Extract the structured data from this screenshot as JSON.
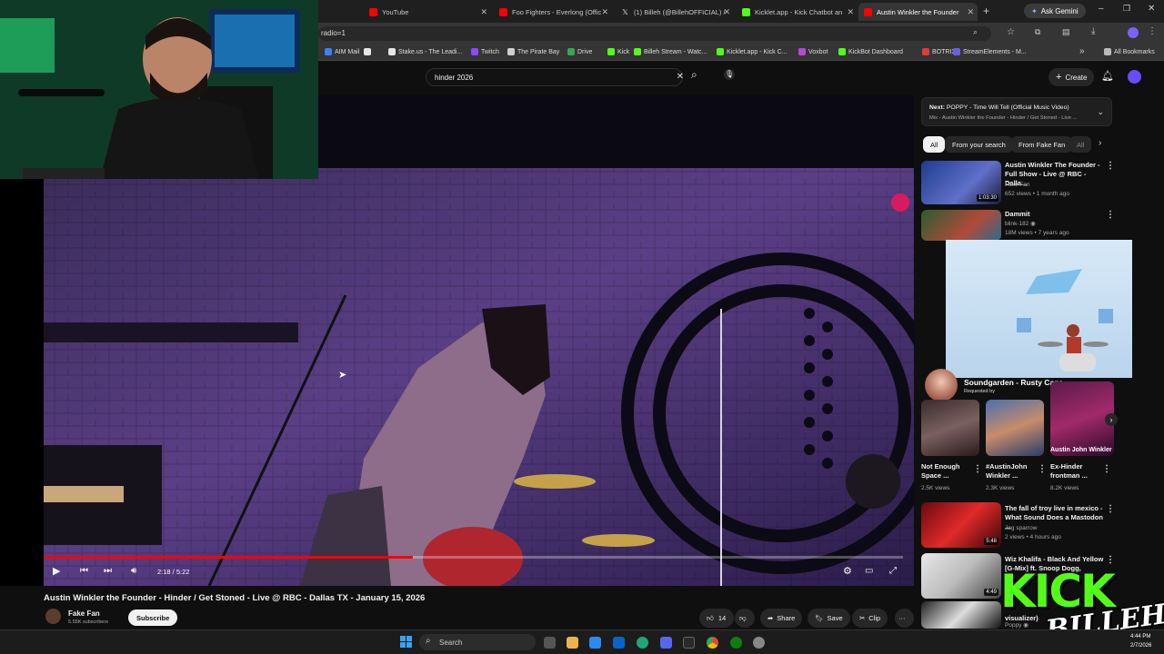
{
  "browser": {
    "tabs": [
      {
        "label": "YouTube",
        "icon": "youtube-icon",
        "color": "#ff0000"
      },
      {
        "label": "Foo Fighters - Everlong (Offic",
        "icon": "youtube-icon",
        "color": "#ff0000"
      },
      {
        "label": "(1) Billeh (@BillehOFFICIAL) /",
        "icon": "x-icon",
        "color": "#e6e6e6"
      },
      {
        "label": "Kicklet.app - Kick Chatbot an",
        "icon": "kicklet-icon",
        "color": "#53fc18"
      },
      {
        "label": "Austin Winkler the Founder",
        "icon": "youtube-icon",
        "color": "#ff0000"
      }
    ],
    "new_tab": "+",
    "gemini": "Ask Gemini",
    "address": "radio=1",
    "bookmarks": [
      {
        "label": "AIM Mail",
        "color": "#3b82f6"
      },
      {
        "label": "",
        "color": "#e6e6e6"
      },
      {
        "label": "Stake.us - The Leadi...",
        "color": "#e6e6e6"
      },
      {
        "label": "Twitch",
        "color": "#9146ff"
      },
      {
        "label": "The Pirate Bay",
        "color": "#cfcfcf"
      },
      {
        "label": "Drive",
        "color": "#34a853"
      },
      {
        "label": "Kick",
        "color": "#53fc18"
      },
      {
        "label": "Billeh Stream - Watc...",
        "color": "#53fc18"
      },
      {
        "label": "Kicklet.app - Kick C...",
        "color": "#53fc18"
      },
      {
        "label": "Voxbot",
        "color": "#b44ad6"
      },
      {
        "label": "KickBot Dashboard",
        "color": "#53fc18"
      },
      {
        "label": "BOTRIX",
        "color": "#e53935"
      },
      {
        "label": "StreamElements - M...",
        "color": "#6c5ce7"
      }
    ],
    "bookmarks_more": "»",
    "all_bookmarks": "All Bookmarks"
  },
  "youtube": {
    "search_value": "hinder 2026",
    "create_label": "Create",
    "video": {
      "title": "Austin Winkler the Founder - Hinder / Get Stoned - Live @ RBC - Dallas TX - January 15, 2026",
      "time": "2:18 / 5:22",
      "progress": 0.43
    },
    "channel": {
      "name": "Fake Fan",
      "subscribers": "5.55K subscribers",
      "subscribe": "Subscribe"
    },
    "actions": {
      "likes": "14",
      "share": "Share",
      "save": "Save",
      "clip": "Clip",
      "more": "···"
    },
    "up_next": {
      "label": "Next:",
      "title": "POPPY - Time Will Tell (Official Music Video)",
      "subtitle": "Mix - Austin Winkler the Founder - Hinder / Get Stoned - Live ..."
    },
    "chips": [
      "All",
      "From your search",
      "From Fake Fan",
      "All"
    ],
    "recommendations": [
      {
        "title": "Austin Winkler The Founder - Full Show - Live @ RBC - Dalla...",
        "channel": "Fake Fan",
        "meta": "652 views • 1 month ago",
        "duration": "1:03:30"
      },
      {
        "title": "Dammit",
        "channel": "blink-182 ◉",
        "meta": "18M views • 7 years ago",
        "duration": ""
      }
    ],
    "miniplayer": {
      "title": "Soundgarden - Rusty Cage",
      "requested": "Requested by"
    },
    "shorts": [
      {
        "title": "Not Enough Space ...",
        "views": "2.5K views",
        "overlay": ""
      },
      {
        "title": "#AustinJohn Winkler ...",
        "views": "2.3K views",
        "overlay": ""
      },
      {
        "title": "Ex-Hinder frontman ...",
        "views": "8.2K views",
        "overlay": "Austin John Winkler"
      }
    ],
    "more_recs": [
      {
        "title": "The fall of troy live in mexico - What Sound Does a Mastodon ...",
        "channel": "Jag sparrow",
        "meta": "2 views • 4 hours ago",
        "duration": "5:48"
      },
      {
        "title": "Wiz Khalifa - Black And Yellow [G-Mix] ft. Snoop Dogg, Juicy...",
        "channel": "",
        "meta": "",
        "duration": "4:49"
      },
      {
        "title": "visualizer)",
        "channel": "Poppy ◉",
        "meta": "",
        "duration": ""
      }
    ]
  },
  "overlay": {
    "brand_line1": "KICK",
    "brand_line2": "BILLEH"
  },
  "taskbar": {
    "search": "Search",
    "time": "4:44 PM",
    "date": "2/7/2026"
  }
}
